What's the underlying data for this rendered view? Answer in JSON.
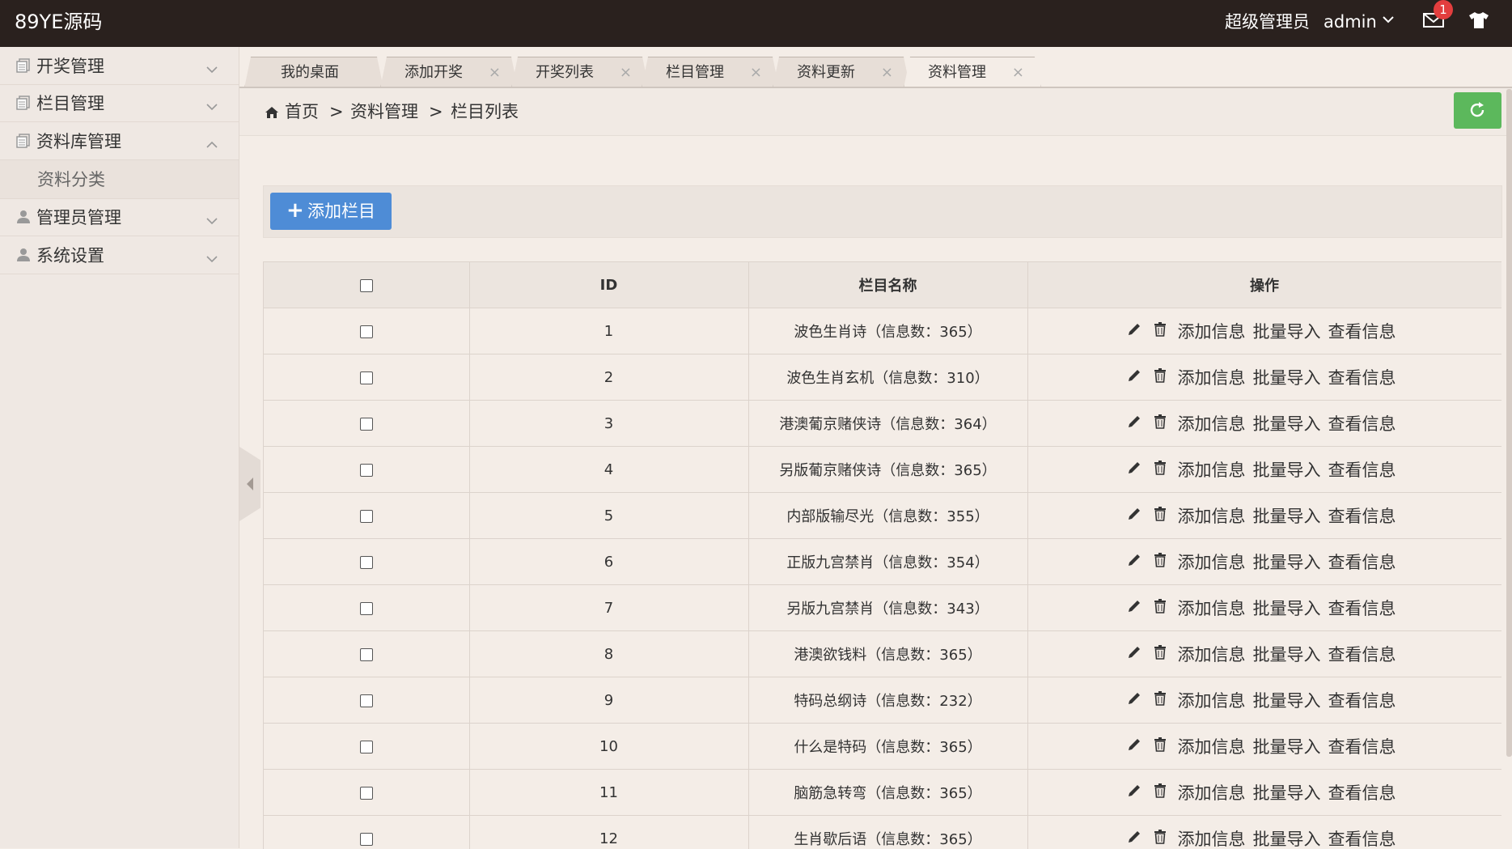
{
  "app": {
    "logo": "89YE源码",
    "user_role": "超级管理员",
    "user_name": "admin",
    "message_count": "1",
    "accent": "#4e8cd6",
    "success": "#5cb85c"
  },
  "sidebar": {
    "items": [
      {
        "label": "开奖管理",
        "icon": "list-icon",
        "expanded": false
      },
      {
        "label": "栏目管理",
        "icon": "list-icon",
        "expanded": false
      },
      {
        "label": "资料库管理",
        "icon": "list-icon",
        "expanded": true
      },
      {
        "label": "管理员管理",
        "icon": "user-icon",
        "expanded": false
      },
      {
        "label": "系统设置",
        "icon": "user-icon",
        "expanded": false
      }
    ],
    "subitems": [
      {
        "label": "资料分类"
      }
    ]
  },
  "tabs": [
    {
      "label": "我的桌面",
      "closable": false
    },
    {
      "label": "添加开奖",
      "closable": true
    },
    {
      "label": "开奖列表",
      "closable": true
    },
    {
      "label": "栏目管理",
      "closable": true
    },
    {
      "label": "资料更新",
      "closable": true
    },
    {
      "label": "资料管理",
      "closable": true,
      "active": true
    }
  ],
  "tab_close_symbol": "×",
  "breadcrumb": {
    "home": "首页",
    "separator": ">",
    "level1": "资料管理",
    "level2": "栏目列表"
  },
  "toolbar": {
    "add_label": "添加栏目",
    "add_icon": "+"
  },
  "table": {
    "columns": [
      "ID",
      "栏目名称",
      "操作"
    ],
    "actions": [
      "添加信息",
      "批量导入",
      "查看信息"
    ],
    "rows": [
      {
        "id": "1",
        "name": "波色生肖诗（信息数：365）"
      },
      {
        "id": "2",
        "name": "波色生肖玄机（信息数：310）"
      },
      {
        "id": "3",
        "name": "港澳葡京赌侠诗（信息数：364）"
      },
      {
        "id": "4",
        "name": "另版葡京赌侠诗（信息数：365）"
      },
      {
        "id": "5",
        "name": "内部版输尽光（信息数：355）"
      },
      {
        "id": "6",
        "name": "正版九宫禁肖（信息数：354）"
      },
      {
        "id": "7",
        "name": "另版九宫禁肖（信息数：343）"
      },
      {
        "id": "8",
        "name": "港澳欲钱料（信息数：365）"
      },
      {
        "id": "9",
        "name": "特码总纲诗（信息数：232）"
      },
      {
        "id": "10",
        "name": "什么是特码（信息数：365）"
      },
      {
        "id": "11",
        "name": "脑筋急转弯（信息数：365）"
      },
      {
        "id": "12",
        "name": "生肖歇后语（信息数：365）"
      }
    ]
  }
}
